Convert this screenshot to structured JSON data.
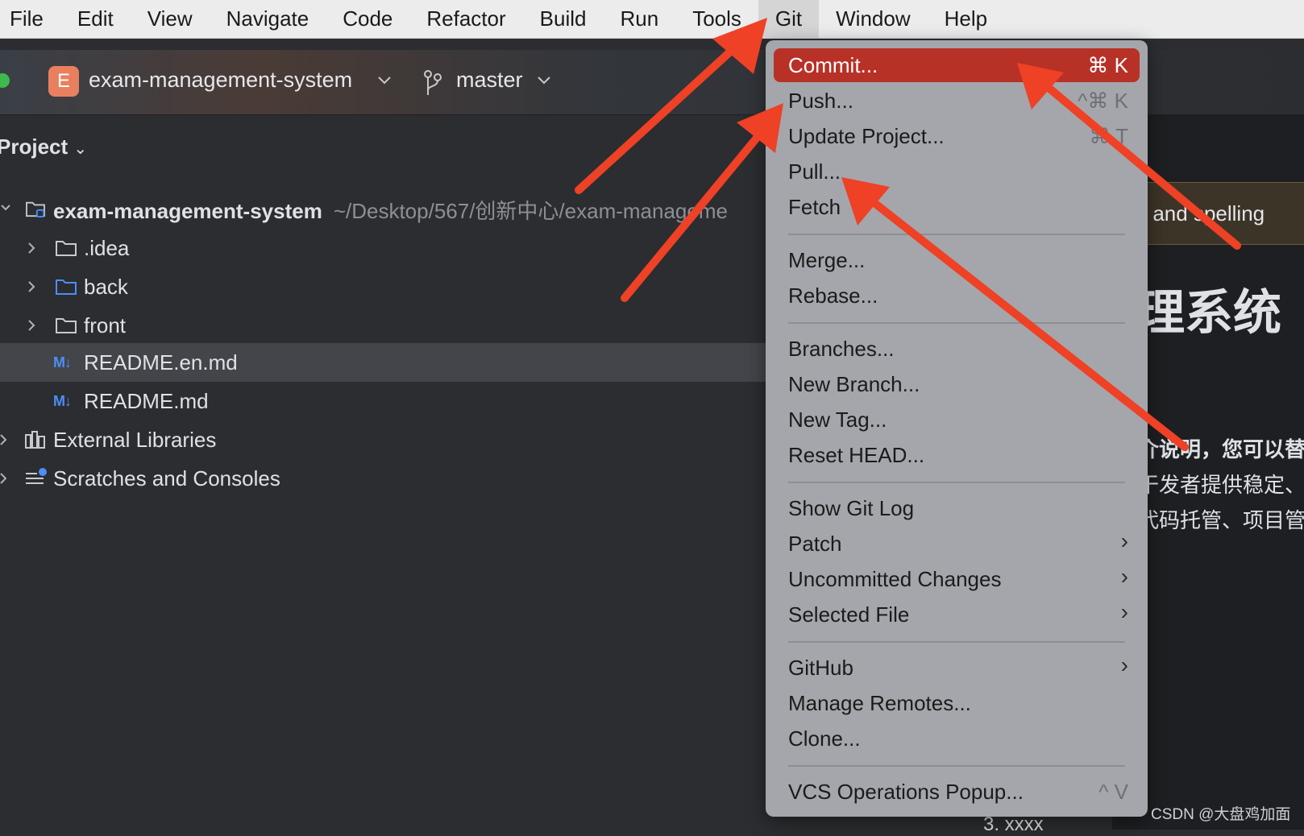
{
  "menubar": {
    "items": [
      "File",
      "Edit",
      "View",
      "Navigate",
      "Code",
      "Refactor",
      "Build",
      "Run",
      "Tools",
      "Git",
      "Window",
      "Help"
    ],
    "active": "Git"
  },
  "toolbar": {
    "project_initial": "E",
    "project_name": "exam-management-system",
    "branch": "master"
  },
  "project_pane": {
    "title": "Project",
    "root_name": "exam-management-system",
    "root_path": "~/Desktop/567/创新中心/exam-manageme",
    "items": [
      ".idea",
      "back",
      "front",
      "README.en.md",
      "README.md"
    ],
    "external_libraries": "External Libraries",
    "scratches": "Scratches and Consoles",
    "md_badge": "M↓"
  },
  "git_menu": {
    "commit": "Commit...",
    "commit_shortcut": "⌘ K",
    "push": "Push...",
    "push_shortcut": "^⌘ K",
    "update": "Update Project...",
    "update_shortcut": "⌘ T",
    "pull": "Pull...",
    "fetch": "Fetch",
    "merge": "Merge...",
    "rebase": "Rebase...",
    "branches": "Branches...",
    "new_branch": "New Branch...",
    "new_tag": "New Tag...",
    "reset_head": "Reset HEAD...",
    "show_git_log": "Show Git Log",
    "patch": "Patch",
    "uncommitted": "Uncommitted Changes",
    "selected_file": "Selected File",
    "github": "GitHub",
    "manage_remotes": "Manage Remotes...",
    "clone": "Clone...",
    "vcs_popup": "VCS Operations Popup...",
    "vcs_shortcut": "^ V",
    "submenu_glyph": "›"
  },
  "editor": {
    "notice": "ar and spelling",
    "heading": "理系统",
    "line1": "介说明，您可以替",
    "line2": "干发者提供稳定、",
    "line3": "代码托管、项目管",
    "bottom": "3. xxxx"
  },
  "watermark": "CSDN @大盘鸡加面",
  "colors": {
    "highlight": "#b83127",
    "arrow": "#ee4126",
    "menu_bg": "#a4a6ab"
  }
}
